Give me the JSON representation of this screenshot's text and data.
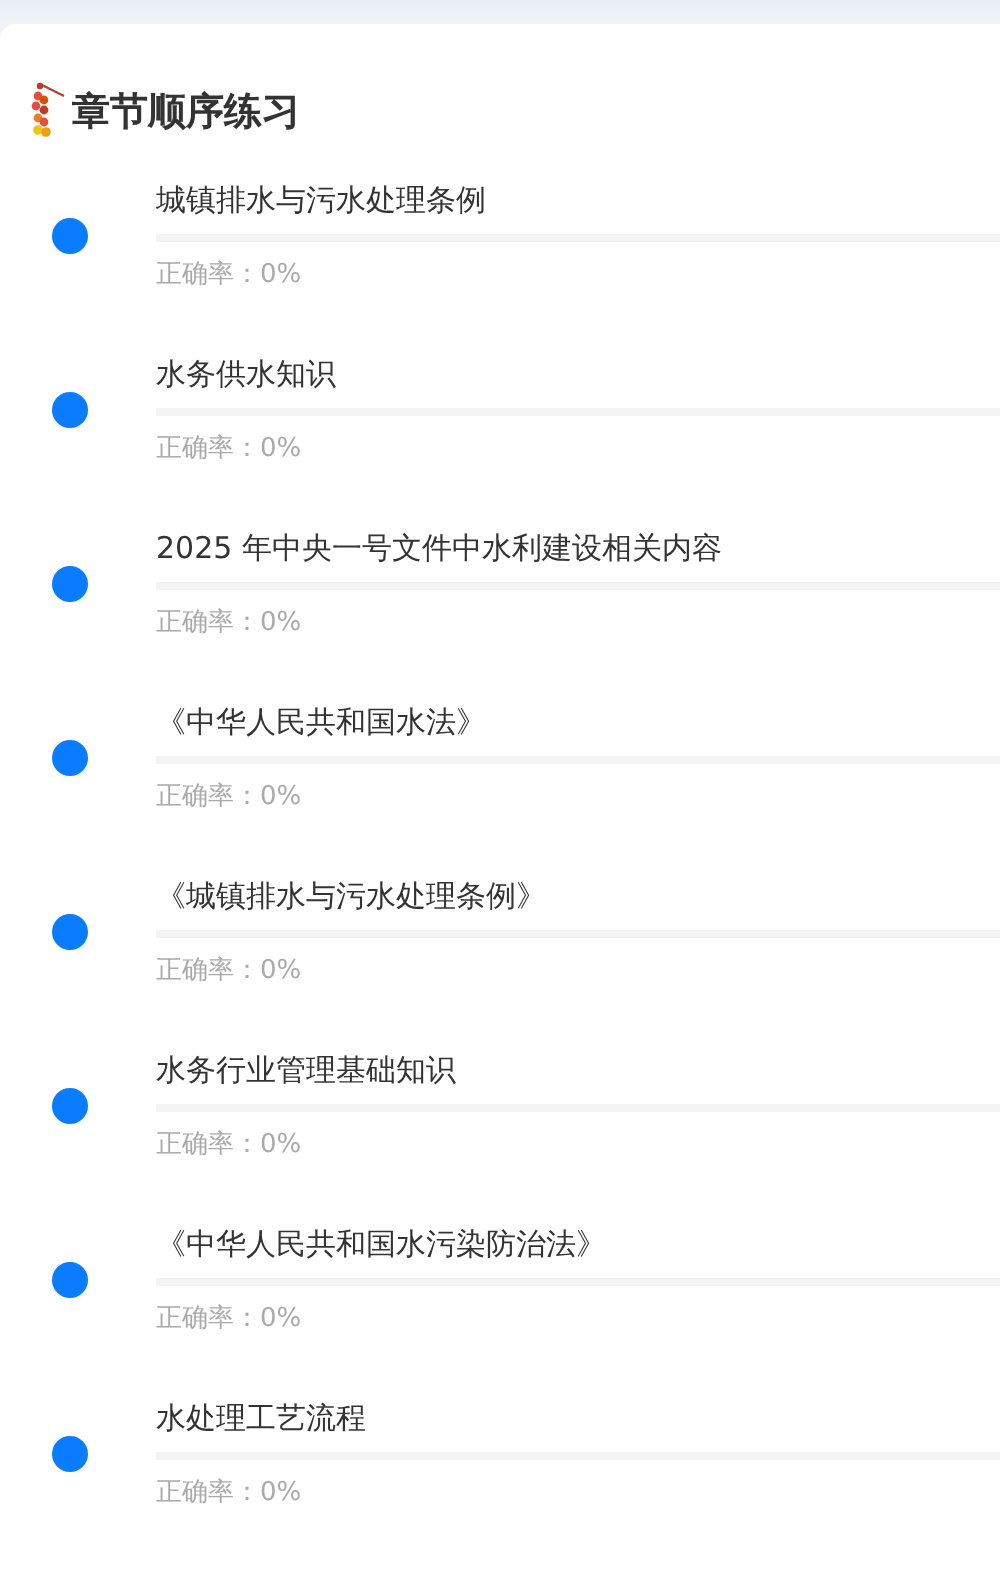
{
  "header": {
    "title": "章节顺序练习"
  },
  "chapters": [
    {
      "title": "城镇排水与污水处理条例",
      "level": 0,
      "accuracy": "正确率：0%"
    },
    {
      "title": "水务供水知识",
      "level": 0,
      "accuracy": "正确率：0%"
    },
    {
      "title": "2025 年中央一号文件中水利建设相关内容",
      "level": 0,
      "accuracy": "正确率：0%"
    },
    {
      "title": "《中华人民共和国水法》",
      "level": 0,
      "accuracy": "正确率：0%"
    },
    {
      "title": "《城镇排水与污水处理条例》",
      "level": 0,
      "accuracy": "正确率：0%"
    },
    {
      "title": "水务行业管理基础知识",
      "level": 0,
      "accuracy": "正确率：0%"
    },
    {
      "title": "《中华人民共和国水污染防治法》",
      "level": 0,
      "accuracy": "正确率：0%"
    },
    {
      "title": "水处理工艺流程",
      "level": 0,
      "accuracy": "正确率：0%"
    }
  ]
}
